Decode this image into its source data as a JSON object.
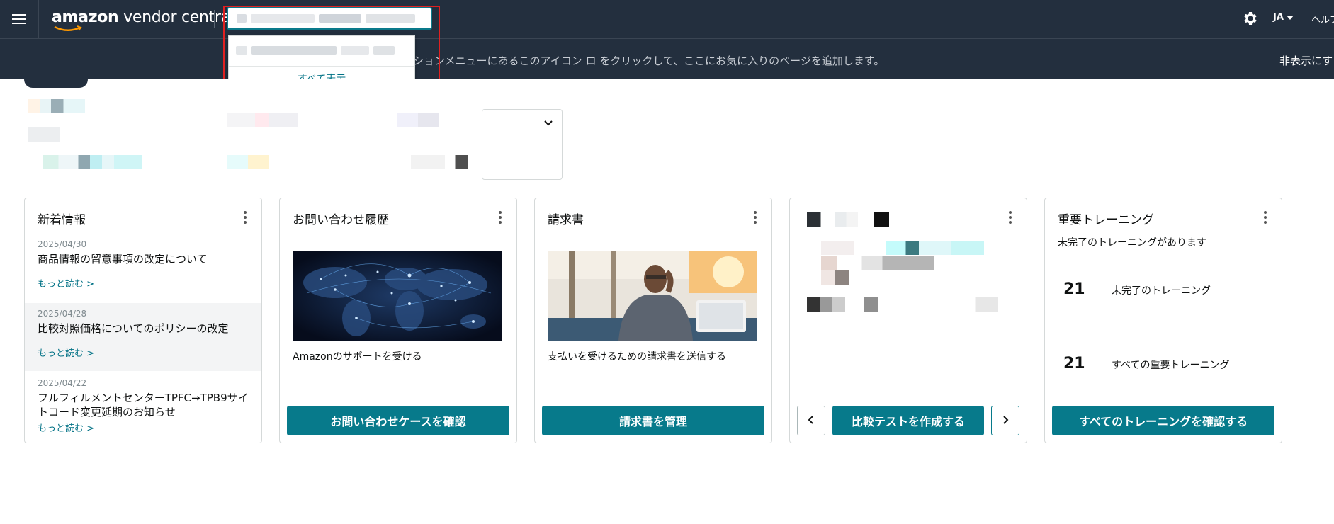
{
  "header": {
    "logo_text": "amazon vendor central",
    "logo_brand": "amazon",
    "logo_product": "vendor central",
    "search_placeholder": "",
    "language": "JA",
    "help": "ヘルプ",
    "icons": {
      "menu": "hamburger-menu-icon",
      "settings": "gear-icon",
      "language_caret": "caret-down-icon"
    }
  },
  "favorites_bar": {
    "hint": "ションメニューにあるこのアイコン ロ をクリックして、ここにお気に入りのページを追加します。",
    "hide": "非表示にす"
  },
  "search_dropdown": {
    "show_all": "すべて表示"
  },
  "cards": {
    "news": {
      "title": "新着情報",
      "items": [
        {
          "date": "2025/04/30",
          "headline": "商品情報の留意事項の改定について",
          "more": "もっと読む >"
        },
        {
          "date": "2025/04/28",
          "headline": "比較対照価格についてのポリシーの改定",
          "more": "もっと読む >"
        },
        {
          "date": "2025/04/22",
          "headline": "フルフィルメントセンターTPFC→TPB9サイトコード変更延期のお知らせ",
          "more": "もっと読む >"
        }
      ]
    },
    "support": {
      "title": "お問い合わせ履歴",
      "description": "Amazonのサポートを受ける",
      "button": "お問い合わせケースを確認"
    },
    "invoices": {
      "title": "請求書",
      "description": "支払いを受けるための請求書を送信する",
      "button": "請求書を管理"
    },
    "experiments": {
      "button": "比較テストを作成する"
    },
    "training": {
      "title": "重要トレーニング",
      "subtitle": "未完了のトレーニングがあります",
      "stats": [
        {
          "count": "21",
          "label": "未完了のトレーニング"
        },
        {
          "count": "21",
          "label": "すべての重要トレーニング"
        }
      ]
    }
  },
  "colors": {
    "nav_bg": "#232f3e",
    "accent": "#077a8b",
    "link": "#007185",
    "highlight_box": "#e02020"
  }
}
